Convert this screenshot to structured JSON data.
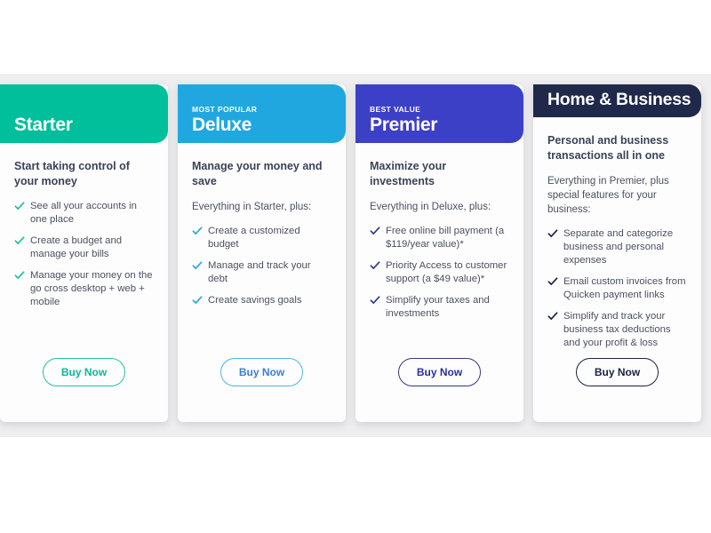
{
  "page": {
    "background": "#ffffff",
    "band_color": "#eeeef0"
  },
  "plans": [
    {
      "id": "starter",
      "ribbon": "",
      "name": "Starter",
      "header_color": "#00bf9a",
      "accent": "#00bf9a",
      "check_color": "#1fbf9f",
      "button_label": "Buy Now",
      "button_text_color": "#0bb89b",
      "button_border_color": "#27bfa4",
      "tagline": "Start taking control of your money",
      "everything": "",
      "features": [
        "See all your accounts in one place",
        "Create a budget and manage your bills",
        "Manage your money on the go cross desktop + web + mobile"
      ]
    },
    {
      "id": "deluxe",
      "ribbon": "MOST POPULAR",
      "name": "Deluxe",
      "header_color": "#21a7e0",
      "accent": "#21a7e0",
      "check_color": "#2aa8d8",
      "button_label": "Buy Now",
      "button_text_color": "#3a7fd5",
      "button_border_color": "#4fb4e0",
      "tagline": "Manage your money and save",
      "everything": "Everything in Starter, plus:",
      "features": [
        "Create a customized budget",
        "Manage and track your debt",
        "Create savings goals"
      ]
    },
    {
      "id": "premier",
      "ribbon": "BEST VALUE",
      "name": "Premier",
      "header_color": "#3c40c6",
      "accent": "#3c40c6",
      "check_color": "#2f3a8f",
      "button_label": "Buy Now",
      "button_text_color": "#2a309e",
      "button_border_color": "#343a7e",
      "tagline": "Maximize your investments",
      "everything": "Everything in Deluxe, plus:",
      "features": [
        "Free online bill payment (a $119/year value)*",
        "Priority Access to customer support (a $49 value)*",
        "Simplify your taxes and investments"
      ]
    },
    {
      "id": "home-and-business",
      "ribbon": "",
      "name": "Home & Business",
      "header_color": "#20294a",
      "accent": "#20294a",
      "check_color": "#1c2440",
      "button_label": "Buy Now",
      "button_text_color": "#1c2440",
      "button_border_color": "#1c2440",
      "tagline": "Personal and business transactions all in one",
      "everything": "Everything in Premier, plus special features for your business:",
      "features": [
        "Separate and categorize business and personal expenses",
        "Email custom invoices from Quicken payment links",
        "Simplify and track your business tax deductions and your profit & loss"
      ]
    }
  ]
}
